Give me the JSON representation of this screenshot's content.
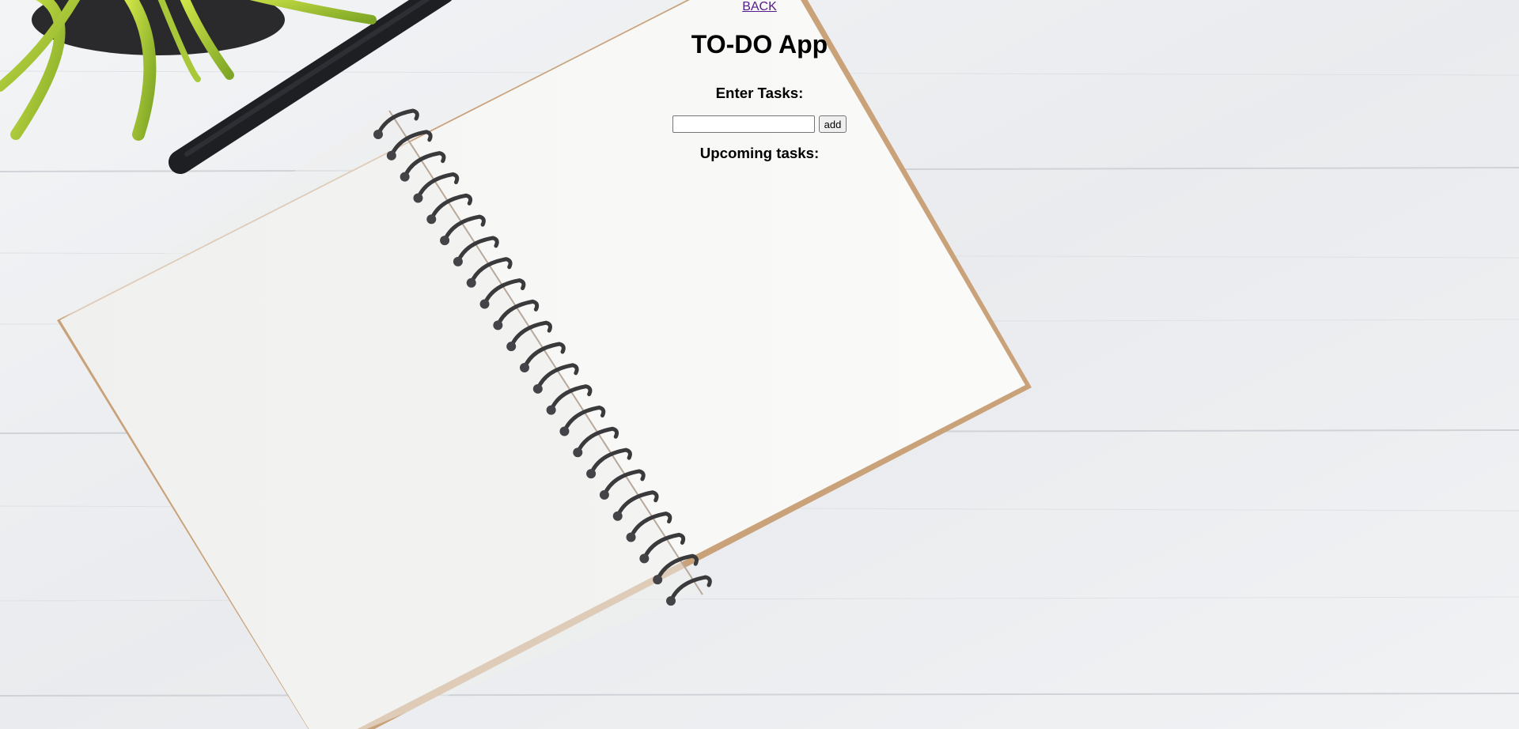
{
  "nav": {
    "back_label": "BACK"
  },
  "app": {
    "title": "TO-DO App",
    "enter_heading": "Enter Tasks:",
    "input_value": "",
    "add_label": "add",
    "upcoming_heading": "Upcoming tasks:",
    "tasks": []
  },
  "theme": {
    "link_color": "#551a8b",
    "text_color": "#000000",
    "desk_color": "#eceff1",
    "paper_color": "#f6f6f4",
    "cover_edge_color": "#c9a27a"
  },
  "background": {
    "description_icons": [
      "desk-background",
      "notebook-image",
      "pen-image",
      "plant-image"
    ]
  }
}
